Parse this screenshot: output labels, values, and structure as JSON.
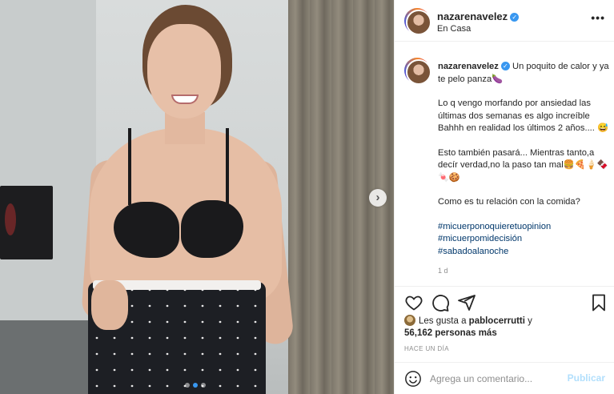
{
  "post": {
    "username": "nazarenavelez",
    "verified": true,
    "location": "En Casa",
    "more_label": "•••"
  },
  "caption": {
    "username": "nazarenavelez",
    "line1": "Un poquito de calor y ya te pelo panza🍆",
    "para2": "Lo q vengo morfando por ansiedad las últimas dos semanas es algo increíble Bahhh en realidad los últimos 2 años.... 😅",
    "para3": "Esto también pasará... Mientras tanto,a decír verdad,no la paso tan mal🍔🍕🍦🍫🍬🍪",
    "para4": "Como es tu relación con la comida?",
    "hashtags": [
      "#micuerponoquieretuopinion",
      "#micuerpomidecisión",
      "#sabadoalanoche"
    ],
    "time": "1 d"
  },
  "likes": {
    "prefix": "Les gusta a",
    "user": "pablocerrutti",
    "middle": "y",
    "count": "56,162 personas más"
  },
  "date": "HACE UN DÍA",
  "comment": {
    "placeholder": "Agrega un comentario...",
    "post_label": "Publicar"
  },
  "carousel": {
    "next": "›",
    "total": 3,
    "active": 1
  },
  "colors": {
    "link_blue": "#00376b",
    "verified_blue": "#3897f0",
    "post_disabled": "#b2dffc"
  }
}
